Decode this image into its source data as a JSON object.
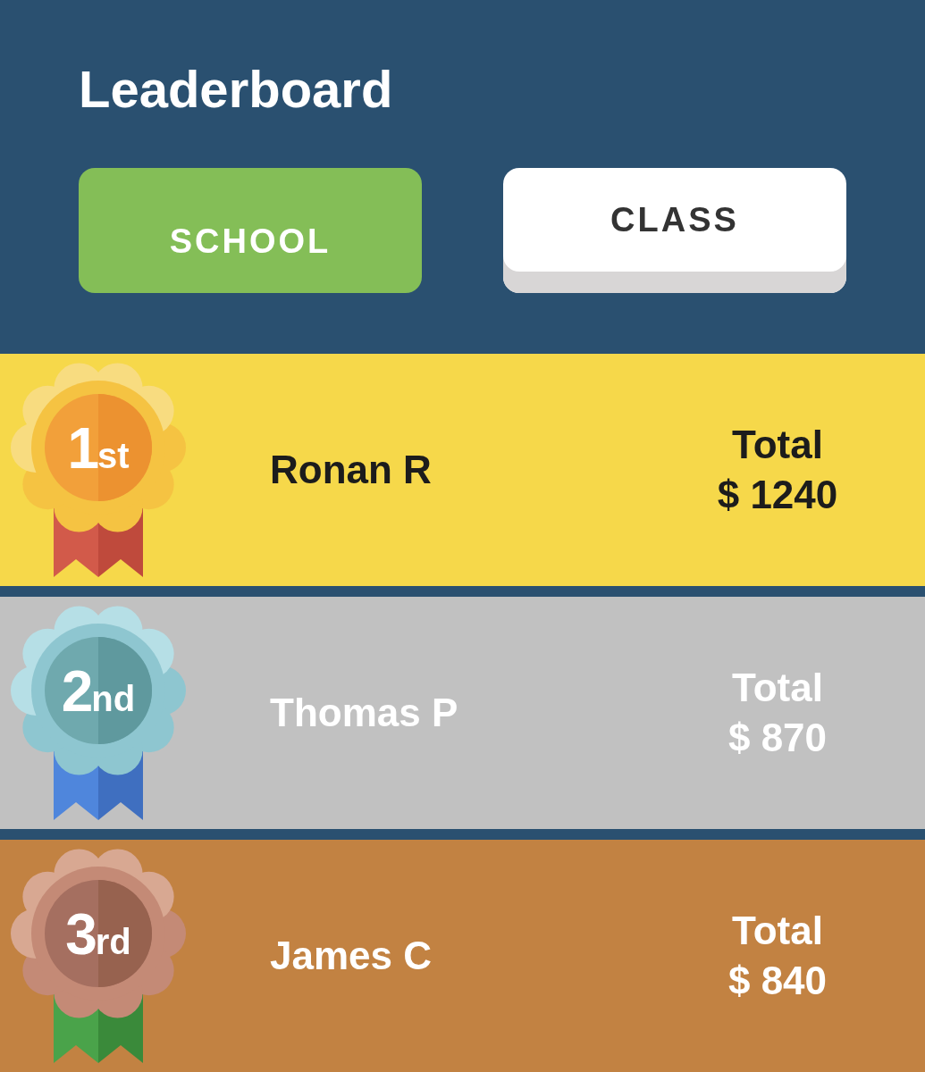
{
  "title": "Leaderboard",
  "tabs": [
    {
      "label": "SCHOOL",
      "selected": true
    },
    {
      "label": "CLASS",
      "selected": false
    }
  ],
  "rows": [
    {
      "kind": "gold",
      "rank": "1",
      "suffix": "st",
      "name": "Ronan R",
      "total_label": "Total",
      "total": "$ 1240"
    },
    {
      "kind": "silver",
      "rank": "2",
      "suffix": "nd",
      "name": "Thomas P",
      "total_label": "Total",
      "total": "$ 870"
    },
    {
      "kind": "bronze",
      "rank": "3",
      "suffix": "rd",
      "name": "James C",
      "total_label": "Total",
      "total": "$ 840"
    }
  ]
}
